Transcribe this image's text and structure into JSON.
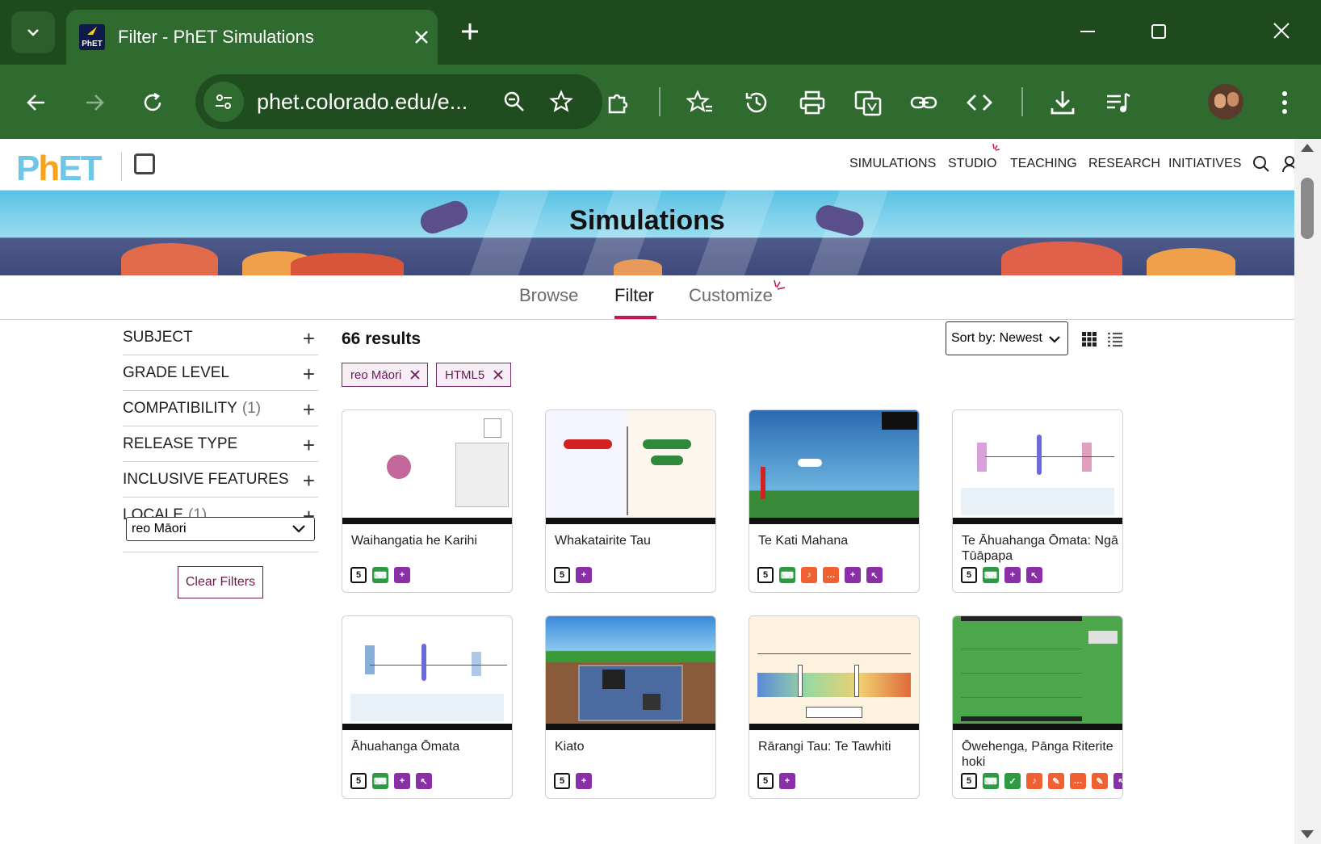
{
  "browser": {
    "tab_title": "Filter - PhET Simulations",
    "favicon_text": "PhET",
    "url": "phet.colorado.edu/e...",
    "icons": {
      "tab_list": "chevron-down-icon",
      "tab_close": "close-icon",
      "new_tab": "plus-icon",
      "minimize": "minimize-icon",
      "maximize": "maximize-icon",
      "close": "close-icon",
      "back": "arrow-left-icon",
      "forward": "arrow-right-icon",
      "reload": "reload-icon",
      "site_info": "tune-icon",
      "zoom": "zoom-icon",
      "bookmark": "star-icon",
      "extensions": "puzzle-icon",
      "favorites": "star-list-icon",
      "history": "history-icon",
      "print": "print-icon",
      "translate": "translate-icon",
      "copy_link": "link-icon",
      "devtools": "code-icon",
      "downloads": "download-icon",
      "media": "media-icon",
      "profile": "avatar-icon",
      "menu": "kebab-menu-icon"
    },
    "colors": {
      "frame": "#1e4a1e",
      "toolbar": "#2f6a2f"
    }
  },
  "site": {
    "logo_text": {
      "p": "P",
      "h": "h",
      "et": "ET"
    },
    "nav": [
      "SIMULATIONS",
      "STUDIO",
      "TEACHING",
      "RESEARCH",
      "INITIATIVES"
    ],
    "hero_title": "Simulations",
    "page_tabs": [
      "Browse",
      "Filter",
      "Customize"
    ],
    "active_tab": "Filter",
    "accent_color": "#c2185b"
  },
  "sidebar": {
    "facets": [
      {
        "label": "SUBJECT",
        "count": ""
      },
      {
        "label": "GRADE LEVEL",
        "count": ""
      },
      {
        "label": "COMPATIBILITY",
        "count": "(1)"
      },
      {
        "label": "RELEASE TYPE",
        "count": ""
      },
      {
        "label": "INCLUSIVE FEATURES",
        "count": ""
      },
      {
        "label": "LOCALE",
        "count": "(1)"
      }
    ],
    "locale_value": "reo Māori",
    "clear_label": "Clear Filters"
  },
  "results": {
    "count_label": "66 results",
    "sort_label": "Sort by:",
    "sort_value": "Newest",
    "chips": [
      "reo Māori",
      "HTML5"
    ],
    "cards": [
      {
        "title": "Waihangatia he Karihi",
        "icons": [
          "html5",
          "kbd",
          "zoom"
        ]
      },
      {
        "title": "Whakatairite Tau",
        "icons": [
          "html5",
          "zoom"
        ]
      },
      {
        "title": "Te Kati Mahana",
        "icons": [
          "html5",
          "kbd",
          "sound",
          "voice",
          "zoom",
          "mouse"
        ]
      },
      {
        "title": "Te Āhuahanga Ōmata: Ngā Tūāpapa",
        "icons": [
          "html5",
          "kbd",
          "zoom",
          "mouse"
        ]
      },
      {
        "title": "Āhuahanga Ōmata",
        "icons": [
          "html5",
          "kbd",
          "zoom",
          "mouse"
        ]
      },
      {
        "title": "Kiato",
        "icons": [
          "html5",
          "zoom"
        ]
      },
      {
        "title": "Rārangi Tau: Te Tawhiti",
        "icons": [
          "html5",
          "zoom"
        ]
      },
      {
        "title": "Ōwehenga, Pānga Riterite hoki",
        "icons": [
          "html5",
          "kbd",
          "alt",
          "sound",
          "inter",
          "voice",
          "inter",
          "mouse"
        ]
      }
    ]
  }
}
